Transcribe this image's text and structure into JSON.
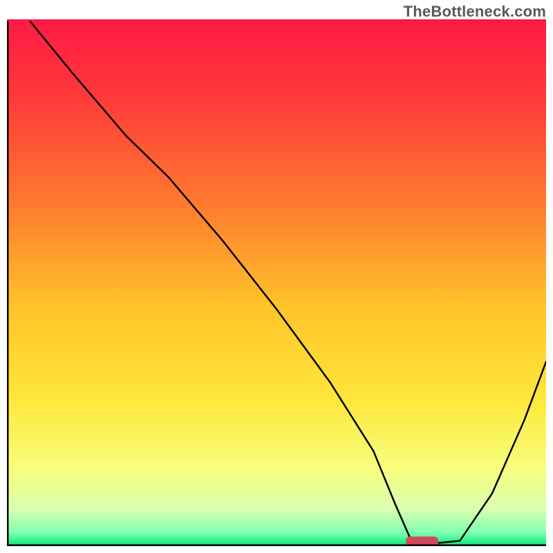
{
  "watermark": "TheBottleneck.com",
  "chart_data": {
    "type": "line",
    "title": "",
    "xlabel": "",
    "ylabel": "",
    "xlim": [
      0,
      100
    ],
    "ylim": [
      0,
      100
    ],
    "grid": false,
    "legend": false,
    "gradient_stops": [
      {
        "offset": 0.0,
        "color": "#ff1a44"
      },
      {
        "offset": 0.15,
        "color": "#ff3a3a"
      },
      {
        "offset": 0.35,
        "color": "#ff7a2f"
      },
      {
        "offset": 0.55,
        "color": "#ffc52a"
      },
      {
        "offset": 0.72,
        "color": "#ffe63a"
      },
      {
        "offset": 0.85,
        "color": "#f7ff7a"
      },
      {
        "offset": 0.93,
        "color": "#d9ffb0"
      },
      {
        "offset": 0.975,
        "color": "#7fffb0"
      },
      {
        "offset": 1.0,
        "color": "#00e676"
      }
    ],
    "inner_frame_colors": {
      "top_border": "#ff1344",
      "right_border_top": "#ff1344",
      "right_border_bottom": "#00e676"
    },
    "series": [
      {
        "name": "bottleneck-curve",
        "x": [
          4,
          12,
          22,
          30,
          40,
          50,
          60,
          68,
          72,
          75,
          79,
          84,
          90,
          96,
          100
        ],
        "y": [
          100,
          90,
          78,
          70,
          58,
          45,
          31,
          18,
          8,
          1,
          0.5,
          1,
          10,
          24,
          35
        ]
      }
    ],
    "marker": {
      "name": "optimal-range",
      "x_center": 77,
      "y_center": 0.8,
      "width": 6,
      "height": 2,
      "color": "#d24a5a"
    }
  }
}
